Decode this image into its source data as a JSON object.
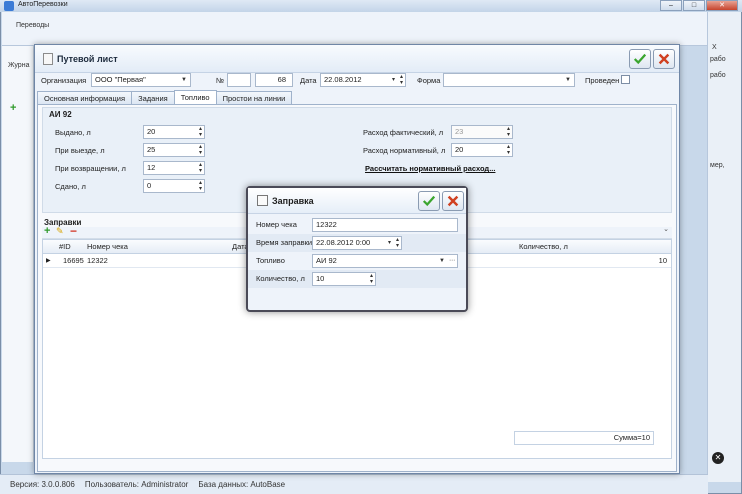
{
  "app": {
    "title": "АвтоПеревозки",
    "ribbon_tab": "Переводы",
    "side_label": "Журна",
    "right_labels": [
      "Х",
      "рабо",
      "рабо",
      "мер,"
    ]
  },
  "status": {
    "version": "Версия: 3.0.0.806",
    "user": "Пользователь: Administrator",
    "database": "База данных: AutoBase"
  },
  "doc": {
    "title": "Путевой лист",
    "org_label": "Организация",
    "org_value": "ООО \"Первая\"",
    "num_label": "№",
    "num_prefix": "",
    "num_value": "68",
    "date_label": "Дата",
    "date_value": "22.08.2012",
    "form_label": "Форма",
    "form_value": "",
    "posted_label": "Проведен",
    "posted": false,
    "tabs": [
      "Основная информация",
      "Задания",
      "Топливо",
      "Простои на линии"
    ],
    "active_tab": 2
  },
  "fuel": {
    "group_title": "АИ 92",
    "issued_label": "Выдано, л",
    "issued": "20",
    "departure_label": "При выезде, л",
    "departure": "25",
    "return_label": "При возвращении, л",
    "return": "12",
    "handed_label": "Сдано, л",
    "handed": "0",
    "actual_label": "Расход фактический, л",
    "actual": "23",
    "norm_label": "Расход нормативный, л",
    "norm": "20",
    "calc_link": "Рассчитать нормативный расход..."
  },
  "refuels": {
    "title": "Заправки",
    "columns": [
      "#ID",
      "Номер чека",
      "Дата",
      "Количество, л"
    ],
    "rows": [
      {
        "id": "16695",
        "check": "12322",
        "quantity": "10"
      }
    ],
    "sum": "Сумма=10"
  },
  "dialog": {
    "title": "Заправка",
    "check_label": "Номер чека",
    "check_value": "12322",
    "time_label": "Время заправки",
    "time_value": "22.08.2012 0:00",
    "fuel_label": "Топливо",
    "fuel_value": "АИ 92",
    "qty_label": "Количество, л",
    "qty_value": "10"
  },
  "colors": {
    "ok_green": "#3aa52e",
    "cancel_red": "#d04020",
    "add_green": "#2f9a2a",
    "remove_red": "#d33a2a"
  }
}
